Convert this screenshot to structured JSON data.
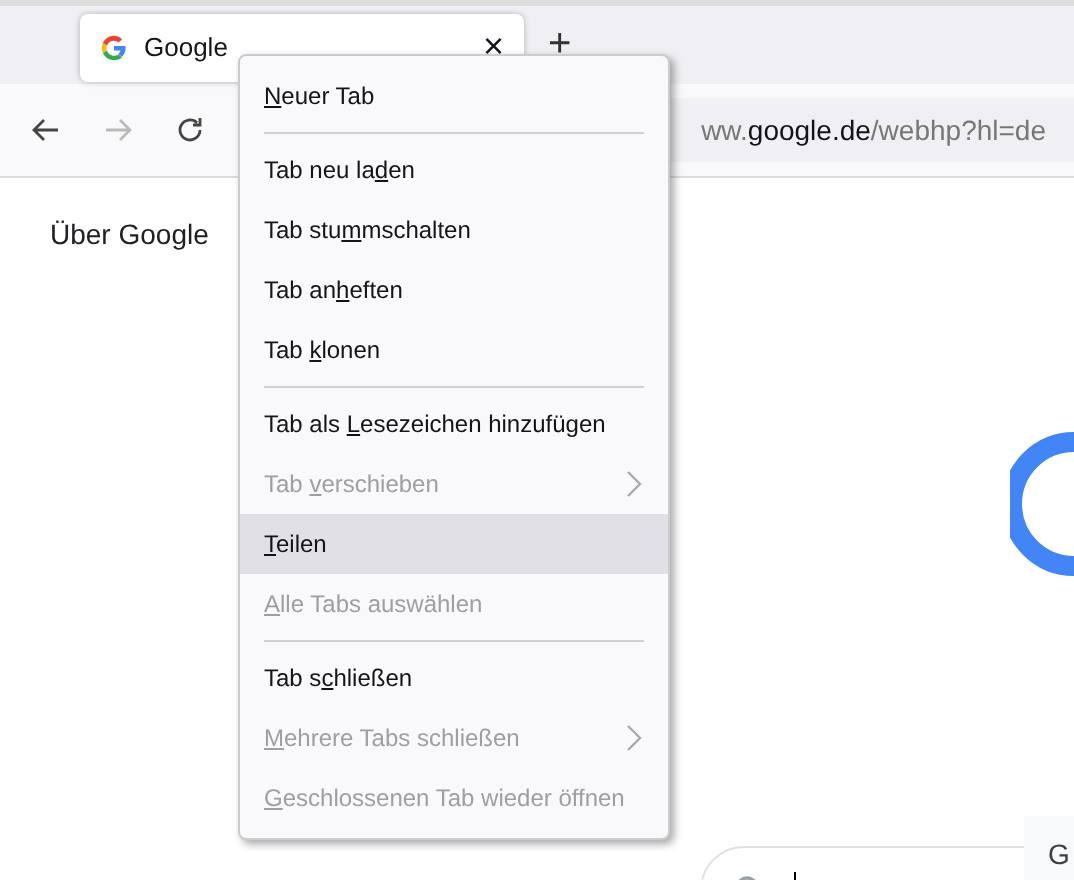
{
  "tab": {
    "title": "Google",
    "close": "×",
    "selected": true
  },
  "new_tab": "+",
  "toolbar": {
    "back_disabled": false,
    "forward_disabled": true,
    "url": {
      "host_start": "ww.",
      "domain": "google.de",
      "path": "/webhp?hl=de"
    }
  },
  "page": {
    "about_link": "Über Google",
    "button_partial": "G"
  },
  "context_menu": [
    {
      "kind": "item",
      "key": "N",
      "after": "euer Tab",
      "disabled": false,
      "selected": false,
      "submenu": false
    },
    {
      "kind": "separator"
    },
    {
      "kind": "item",
      "before": "Tab neu la",
      "key": "d",
      "after": "en",
      "disabled": false,
      "selected": false,
      "submenu": false
    },
    {
      "kind": "item",
      "before": "Tab stu",
      "key": "m",
      "after": "mschalten",
      "disabled": false,
      "selected": false,
      "submenu": false
    },
    {
      "kind": "item",
      "before": "Tab an",
      "key": "h",
      "after": "eften",
      "disabled": false,
      "selected": false,
      "submenu": false
    },
    {
      "kind": "item",
      "before": "Tab ",
      "key": "k",
      "after": "lonen",
      "disabled": false,
      "selected": false,
      "submenu": false
    },
    {
      "kind": "separator"
    },
    {
      "kind": "item",
      "before": "Tab als ",
      "key": "L",
      "after": "esezeichen hinzufügen",
      "disabled": false,
      "selected": false,
      "submenu": false
    },
    {
      "kind": "item",
      "before": "Tab ",
      "key": "v",
      "after": "erschieben",
      "disabled": true,
      "selected": false,
      "submenu": true
    },
    {
      "kind": "item",
      "key": "T",
      "after": "eilen",
      "disabled": false,
      "selected": true,
      "submenu": false
    },
    {
      "kind": "item",
      "key": "A",
      "after": "lle Tabs auswählen",
      "disabled": true,
      "selected": false,
      "submenu": false
    },
    {
      "kind": "separator"
    },
    {
      "kind": "item",
      "before": "Tab s",
      "key": "c",
      "after": "hließen",
      "disabled": false,
      "selected": false,
      "submenu": false
    },
    {
      "kind": "item",
      "key": "M",
      "after": "ehrere Tabs schließen",
      "disabled": true,
      "selected": false,
      "submenu": true
    },
    {
      "kind": "item",
      "key": "G",
      "after": "eschlossenen Tab wieder öffnen",
      "disabled": true,
      "selected": false,
      "submenu": false
    }
  ]
}
